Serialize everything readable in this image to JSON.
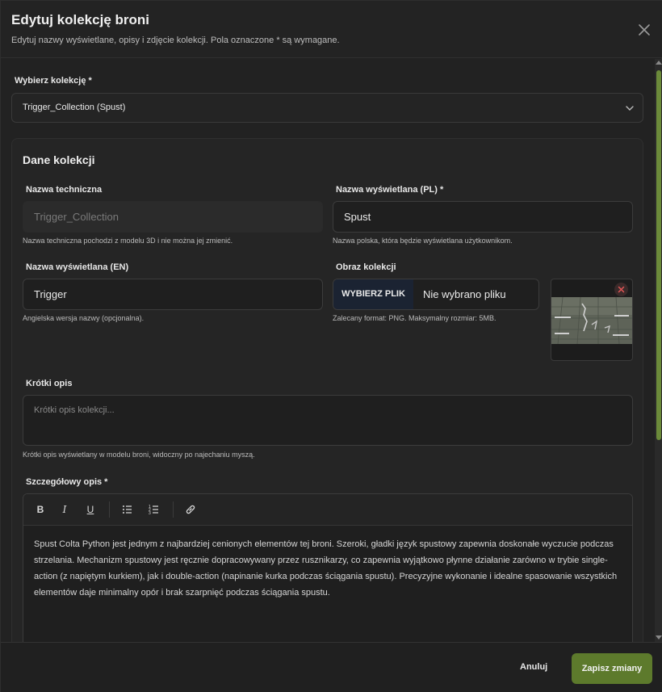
{
  "dialog": {
    "title": "Edytuj kolekcję broni",
    "subtitle": "Edytuj nazwy wyświetlane, opisy i zdjęcie kolekcji. Pola oznaczone * są wymagane."
  },
  "collection_select": {
    "label": "Wybierz kolekcję *",
    "value": "Trigger_Collection (Spust)"
  },
  "section": {
    "title": "Dane kolekcji"
  },
  "technical_name": {
    "label": "Nazwa techniczna",
    "placeholder": "Trigger_Collection",
    "hint": "Nazwa techniczna pochodzi z modelu 3D i nie można jej zmienić."
  },
  "display_name_pl": {
    "label": "Nazwa wyświetlana (PL) *",
    "value": "Spust",
    "hint": "Nazwa polska, która będzie wyświetlana użytkownikom."
  },
  "display_name_en": {
    "label": "Nazwa wyświetlana (EN)",
    "value": "Trigger",
    "hint": "Angielska wersja nazwy (opcjonalna)."
  },
  "image": {
    "label": "Obraz kolekcji",
    "button": "WYBIERZ PLIK",
    "file_status": "Nie wybrano pliku",
    "hint": "Zalecany format: PNG. Maksymalny rozmiar: 5MB."
  },
  "short_description": {
    "label": "Krótki opis",
    "placeholder": "Krótki opis kolekcji...",
    "hint": "Krótki opis wyświetlany w modelu broni, widoczny po najechaniu myszą."
  },
  "detailed_description": {
    "label": "Szczegółowy opis *",
    "toolbar": [
      "bold-icon",
      "italic-icon",
      "underline-icon",
      "bullet-list-icon",
      "numbered-list-icon",
      "link-icon"
    ],
    "content": "Spust Colta Python jest jednym z najbardziej cenionych elementów tej broni. Szeroki, gładki język spustowy zapewnia doskonałe wyczucie podczas strzelania. Mechanizm spustowy jest ręcznie dopracowywany przez rusznikarzy, co zapewnia wyjątkowo płynne działanie zarówno w trybie single-action (z napiętym kurkiem), jak i double-action (napinanie kurka podczas ściągania spustu). Precyzyjne wykonanie i idealne spasowanie wszystkich elementów daje minimalny opór i brak szarpnięć podczas ściągania spustu."
  },
  "footer": {
    "cancel": "Anuluj",
    "save": "Zapisz zmiany"
  },
  "colors": {
    "accent": "#5d7a2c",
    "file_button": "#1b2332",
    "remove": "#e05555"
  }
}
